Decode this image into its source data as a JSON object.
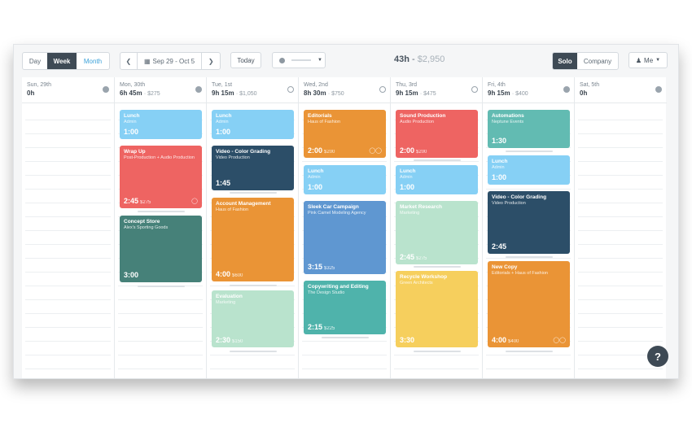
{
  "toolbar": {
    "view_day": "Day",
    "view_week": "Week",
    "view_month": "Month",
    "date_range": "Sep 29 - Oct 5",
    "today": "Today",
    "total_hours": "43h",
    "total_sep": "-",
    "total_amount": "$2,950",
    "solo": "Solo",
    "company": "Company",
    "me": "Me"
  },
  "days": [
    {
      "name": "Sun, 29th",
      "total": "0h",
      "amount": ""
    },
    {
      "name": "Mon, 30th",
      "total": "6h 45m",
      "amount": "· $275"
    },
    {
      "name": "Tue, 1st",
      "total": "9h 15m",
      "amount": "· $1,050"
    },
    {
      "name": "Wed, 2nd",
      "total": "8h 30m",
      "amount": "· $750"
    },
    {
      "name": "Thu, 3rd",
      "total": "9h 15m",
      "amount": "· $475"
    },
    {
      "name": "Fri, 4th",
      "total": "9h 15m",
      "amount": "· $400"
    },
    {
      "name": "Sat, 5th",
      "total": "0h",
      "amount": ""
    }
  ],
  "events": {
    "mon": [
      {
        "title": "Lunch",
        "sub": "Admin",
        "dur": "1:00",
        "amt": ""
      },
      {
        "title": "Wrap Up",
        "sub": "Post-Production + Audio Production",
        "dur": "2:45",
        "amt": "$275"
      },
      {
        "title": "Concept Store",
        "sub": "Alex's Sporting Goods",
        "dur": "3:00",
        "amt": ""
      }
    ],
    "tue": [
      {
        "title": "Lunch",
        "sub": "Admin",
        "dur": "1:00",
        "amt": ""
      },
      {
        "title": "Video - Color Grading",
        "sub": "Video Production",
        "dur": "1:45",
        "amt": ""
      },
      {
        "title": "Account Management",
        "sub": "Haus of Fashion",
        "dur": "4:00",
        "amt": "$600"
      },
      {
        "title": "Evaluation",
        "sub": "Marketing",
        "dur": "2:30",
        "amt": "$150"
      }
    ],
    "wed": [
      {
        "title": "Editorials",
        "sub": "Haus of Fashion",
        "dur": "2:00",
        "amt": "$200"
      },
      {
        "title": "Lunch",
        "sub": "Admin",
        "dur": "1:00",
        "amt": ""
      },
      {
        "title": "Sleek Car Campaign",
        "sub": "Pink Camel Modeling Agency",
        "dur": "3:15",
        "amt": "$325"
      },
      {
        "title": "Copywriting and Editing",
        "sub": "The Design Studio",
        "dur": "2:15",
        "amt": "$225"
      }
    ],
    "thu": [
      {
        "title": "Sound Production",
        "sub": "Audio Production",
        "dur": "2:00",
        "amt": "$200"
      },
      {
        "title": "Lunch",
        "sub": "Admin",
        "dur": "1:00",
        "amt": ""
      },
      {
        "title": "Market Research",
        "sub": "Marketing",
        "dur": "2:45",
        "amt": "$275"
      },
      {
        "title": "Recycle Workshop",
        "sub": "Green Architects",
        "dur": "3:30",
        "amt": ""
      }
    ],
    "fri": [
      {
        "title": "Automations",
        "sub": "Neptune Events",
        "dur": "1:30",
        "amt": ""
      },
      {
        "title": "Lunch",
        "sub": "Admin",
        "dur": "1:00",
        "amt": ""
      },
      {
        "title": "Video - Color Grading",
        "sub": "Video Production",
        "dur": "2:45",
        "amt": ""
      },
      {
        "title": "New Copy",
        "sub": "Editorials + Haus of Fashion",
        "dur": "4:00",
        "amt": "$400"
      }
    ]
  },
  "help": "?"
}
